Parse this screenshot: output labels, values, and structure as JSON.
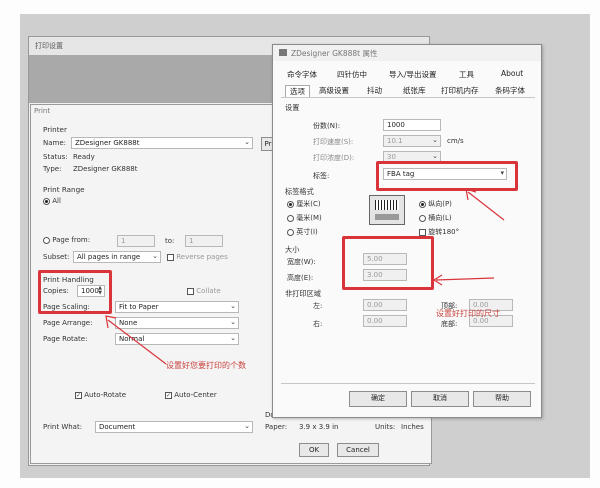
{
  "bg_window": {
    "title": "打印设置"
  },
  "print_dialog": {
    "title": "Print",
    "printer": {
      "group_label": "Printer",
      "name_label": "Name:",
      "name_value": "ZDesigner GK888t",
      "status_label": "Status:",
      "status_value": "Ready",
      "type_label": "Type:",
      "type_value": "ZDesigner GK888t",
      "properties_button": "Pr"
    },
    "print_range": {
      "group_label": "Print Range",
      "all_label": "All",
      "pages_label": "Page from:",
      "from_value": "1",
      "to_label": "to:",
      "to_value": "1",
      "subset_label": "Subset:",
      "subset_value": "All pages in range",
      "reverse_label": "Reverse pages"
    },
    "handling": {
      "group_label": "Print Handling",
      "copies_label": "Copies:",
      "copies_value": "1000",
      "collate_label": "Collate",
      "scaling_label": "Page Scaling:",
      "scaling_value": "Fit to Paper",
      "arrange_label": "Page Arrange:",
      "arrange_value": "None",
      "rotate_label": "Page Rotate:",
      "rotate_value": "Normal"
    },
    "auto_rotate_label": "Auto-Rotate",
    "auto_center_label": "Auto-Center",
    "print_what_label": "Print What:",
    "print_what_value": "Document",
    "doc_label": "Documen",
    "paper_label": "Paper:",
    "paper_value": "3.9 x 3.9 in",
    "units_label": "Units:",
    "units_value": "Inches",
    "ok_button": "OK",
    "cancel_button": "Cancel"
  },
  "zd_dialog": {
    "title": "ZDesigner GK888t 属性",
    "tabs_row1": [
      "命令字体",
      "四针仿中",
      "导入/导出设置",
      "工具",
      "About"
    ],
    "tabs_row2": [
      "选项",
      "高级设置",
      "抖动",
      "纸张库",
      "打印机内存",
      "条码字体"
    ],
    "settings": {
      "group_label": "设置",
      "copies_label": "份数(N):",
      "copies_value": "1000",
      "speed_label": "打印速度(S):",
      "speed_value": "10.1",
      "speed_unit": "cm/s",
      "darkness_label": "打印浓度(D):",
      "darkness_value": "30",
      "stock_label": "标签:",
      "stock_value": "FBA tag"
    },
    "format": {
      "group_label": "标签格式",
      "unit_cm": "厘米(C)",
      "unit_mm": "毫米(M)",
      "unit_in": "英寸(I)",
      "orient_portrait": "纵向(P)",
      "orient_landscape": "横向(L)",
      "rotate_180": "旋转180°"
    },
    "size": {
      "group_label": "大小",
      "width_label": "宽度(W):",
      "width_value": "5.00",
      "height_label": "高度(E):",
      "height_value": "3.00"
    },
    "unprintable": {
      "group_label": "非打印区域",
      "left_label": "左:",
      "left_value": "0.00",
      "right_label": "右:",
      "right_value": "0.00",
      "top_label": "顶部:",
      "top_value": "0.00",
      "bottom_label": "底部:",
      "bottom_value": "0.00"
    },
    "ok_button": "确定",
    "cancel_button": "取消",
    "help_button": "帮助"
  },
  "annotations": {
    "copies_note": "设置好您要打印的个数",
    "size_note": "设置好打印的尺寸"
  },
  "colors": {
    "highlight": "#d9343a",
    "note": "#c8443f"
  }
}
